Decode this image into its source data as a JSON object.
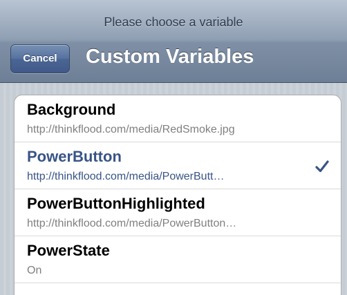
{
  "prompt": "Please choose a variable",
  "navbar": {
    "cancel_label": "Cancel",
    "title": "Custom Variables"
  },
  "colors": {
    "selected_text": "#385487",
    "nav_tint": "#6d7f96"
  },
  "rows": [
    {
      "name": "Background",
      "detail": "http://thinkflood.com/media/RedSmoke.jpg",
      "selected": false
    },
    {
      "name": "PowerButton",
      "detail": "http://thinkflood.com/media/PowerButt…",
      "selected": true,
      "accessory_icon": "checkmark-icon"
    },
    {
      "name": "PowerButtonHighlighted",
      "detail": "http://thinkflood.com/media/PowerButton…",
      "selected": false
    },
    {
      "name": "PowerState",
      "detail": "On",
      "selected": false
    }
  ]
}
